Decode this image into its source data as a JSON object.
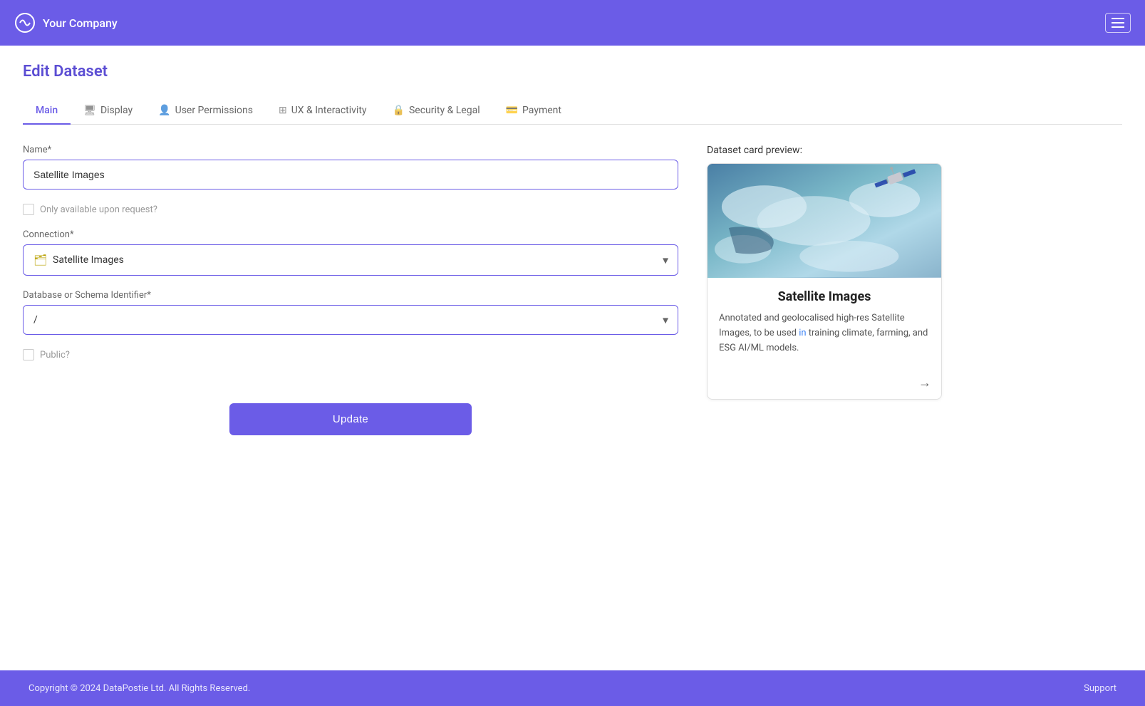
{
  "header": {
    "company_name": "Your Company",
    "menu_label": "menu"
  },
  "page": {
    "title": "Edit Dataset"
  },
  "tabs": [
    {
      "id": "main",
      "label": "Main",
      "icon": "",
      "active": true
    },
    {
      "id": "display",
      "label": "Display",
      "icon": "🖥",
      "active": false
    },
    {
      "id": "user-permissions",
      "label": "User Permissions",
      "icon": "👤",
      "active": false
    },
    {
      "id": "ux-interactivity",
      "label": "UX & Interactivity",
      "icon": "⊞",
      "active": false
    },
    {
      "id": "security-legal",
      "label": "Security & Legal",
      "icon": "🔒",
      "active": false
    },
    {
      "id": "payment",
      "label": "Payment",
      "icon": "🪙",
      "active": false
    }
  ],
  "form": {
    "name_label": "Name*",
    "name_value": "Satellite Images",
    "name_placeholder": "",
    "only_on_request_label": "Only available upon request?",
    "connection_label": "Connection*",
    "connection_value": "Satellite Images",
    "connection_icon": "🗂",
    "db_schema_label": "Database or Schema Identifier*",
    "db_schema_value": "/",
    "public_label": "Public?",
    "update_button": "Update"
  },
  "preview": {
    "section_label": "Dataset card preview:",
    "card_title": "Satellite Images",
    "card_description_part1": "Annotated and geolocalised high-res Satellite Images, to be used ",
    "card_description_highlight": "in",
    "card_description_part2": " training climate, farming, and ESG AI/ML models.",
    "card_description_full": "Annotated and geolocalised high-res Satellite Images, to be used in training climate, farming, and ESG AI/ML models.",
    "arrow": "→"
  },
  "footer": {
    "copyright": "Copyright © 2024 DataPostie Ltd. All Rights Reserved.",
    "support": "Support"
  }
}
